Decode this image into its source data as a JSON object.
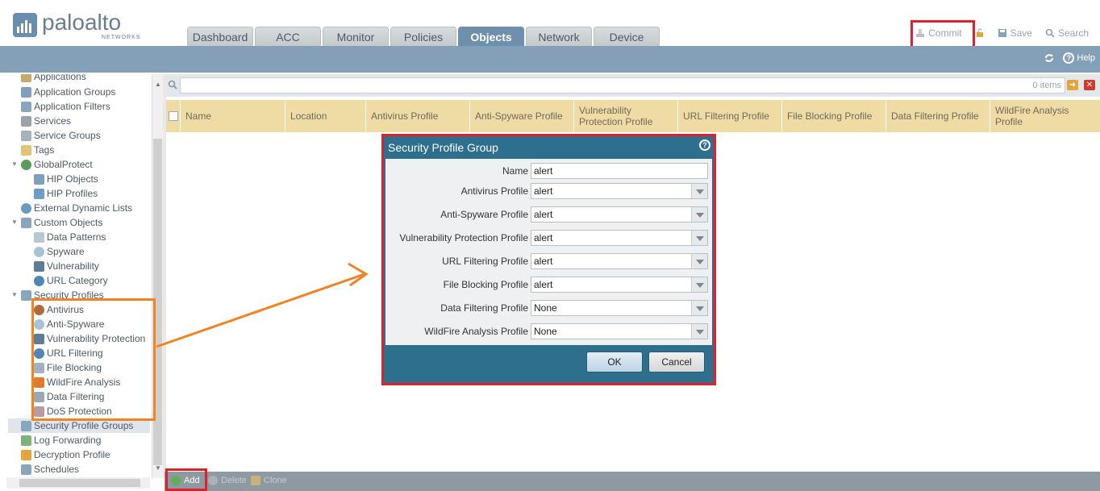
{
  "brand": {
    "name": "paloalto",
    "sub": "NETWORKS"
  },
  "tabs": [
    {
      "label": "Dashboard",
      "active": false
    },
    {
      "label": "ACC",
      "active": false
    },
    {
      "label": "Monitor",
      "active": false
    },
    {
      "label": "Policies",
      "active": false
    },
    {
      "label": "Objects",
      "active": true
    },
    {
      "label": "Network",
      "active": false
    },
    {
      "label": "Device",
      "active": false
    }
  ],
  "header_actions": {
    "commit": "Commit",
    "save": "Save",
    "search": "Search"
  },
  "toolbar": {
    "help": "Help"
  },
  "tree": [
    {
      "label": "Applications",
      "level": 1
    },
    {
      "label": "Application Groups",
      "level": 1
    },
    {
      "label": "Application Filters",
      "level": 1
    },
    {
      "label": "Services",
      "level": 1
    },
    {
      "label": "Service Groups",
      "level": 1
    },
    {
      "label": "Tags",
      "level": 1
    },
    {
      "label": "GlobalProtect",
      "level": 1,
      "expanded": true
    },
    {
      "label": "HIP Objects",
      "level": 2
    },
    {
      "label": "HIP Profiles",
      "level": 2
    },
    {
      "label": "External Dynamic Lists",
      "level": 1
    },
    {
      "label": "Custom Objects",
      "level": 1,
      "expanded": true
    },
    {
      "label": "Data Patterns",
      "level": 2
    },
    {
      "label": "Spyware",
      "level": 2
    },
    {
      "label": "Vulnerability",
      "level": 2
    },
    {
      "label": "URL Category",
      "level": 2
    },
    {
      "label": "Security Profiles",
      "level": 1,
      "expanded": true
    },
    {
      "label": "Antivirus",
      "level": 2
    },
    {
      "label": "Anti-Spyware",
      "level": 2
    },
    {
      "label": "Vulnerability Protection",
      "level": 2
    },
    {
      "label": "URL Filtering",
      "level": 2
    },
    {
      "label": "File Blocking",
      "level": 2
    },
    {
      "label": "WildFire Analysis",
      "level": 2
    },
    {
      "label": "Data Filtering",
      "level": 2
    },
    {
      "label": "DoS Protection",
      "level": 2
    },
    {
      "label": "Security Profile Groups",
      "level": 1,
      "selected": true
    },
    {
      "label": "Log Forwarding",
      "level": 1
    },
    {
      "label": "Decryption Profile",
      "level": 1
    },
    {
      "label": "Schedules",
      "level": 1
    }
  ],
  "search": {
    "count": "0 items"
  },
  "grid": {
    "columns": [
      "Name",
      "Location",
      "Antivirus Profile",
      "Anti-Spyware Profile",
      "Vulnerability Protection Profile",
      "URL Filtering Profile",
      "File Blocking Profile",
      "Data Filtering Profile",
      "WildFire Analysis Profile"
    ]
  },
  "modal": {
    "title": "Security Profile Group",
    "fields": [
      {
        "label": "Name",
        "value": "alert",
        "type": "text"
      },
      {
        "label": "Antivirus Profile",
        "value": "alert",
        "type": "select"
      },
      {
        "label": "Anti-Spyware Profile",
        "value": "alert",
        "type": "select"
      },
      {
        "label": "Vulnerability Protection Profile",
        "value": "alert",
        "type": "select"
      },
      {
        "label": "URL Filtering Profile",
        "value": "alert",
        "type": "select"
      },
      {
        "label": "File Blocking Profile",
        "value": "alert",
        "type": "select"
      },
      {
        "label": "Data Filtering Profile",
        "value": "None",
        "type": "select"
      },
      {
        "label": "WildFire Analysis Profile",
        "value": "None",
        "type": "select"
      }
    ],
    "ok": "OK",
    "cancel": "Cancel"
  },
  "bottom": {
    "add": "Add",
    "delete": "Delete",
    "clone": "Clone"
  },
  "colors": {
    "accent": "#6e90ac",
    "highlight_red": "#e0202a",
    "highlight_orange": "#f08323",
    "modal": "#2e6f8e",
    "grid_header": "#efdba4"
  }
}
